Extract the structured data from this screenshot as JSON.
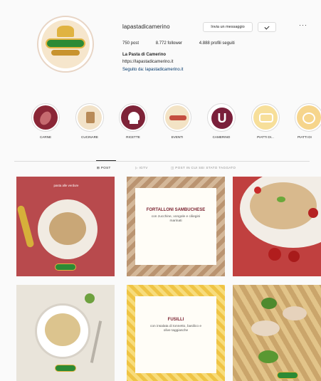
{
  "profile": {
    "username": "lapastadicamerino",
    "message_label": "Invia un messaggio",
    "follow_icon": "person-check-icon",
    "more_label": "···",
    "stats": {
      "posts": "750 post",
      "followers": "8.772 follower",
      "following": "4.888 profili seguiti"
    },
    "bio_name": "La Pasta di Camerino",
    "bio_link": "https://lapastadicamerino.it",
    "bio_link_tag": "Seguito da: lapastadicamerino.it"
  },
  "highlights": [
    {
      "label": "CARNE",
      "color": "#8a2636"
    },
    {
      "label": "CUCINARE",
      "color": "#f2e2c8"
    },
    {
      "label": "RICETTE",
      "color": "#7e2338"
    },
    {
      "label": "EVENTI",
      "color": "#f3e3c5"
    },
    {
      "label": "CAMERINO",
      "color": "#7a1f3a"
    },
    {
      "label": "PIATTI DI...",
      "color": "#f7df9a"
    },
    {
      "label": "PIATTI DI",
      "color": "#f6d58c"
    }
  ],
  "tabs": [
    {
      "label": "⊞ POST",
      "active": true
    },
    {
      "label": "▷ IGTV",
      "active": false
    },
    {
      "label": "◫ POST IN CUI SEI STATO TAGGATO",
      "active": false
    }
  ],
  "posts": [
    {
      "caption": "pasta alle verdure",
      "title": "",
      "sub": ""
    },
    {
      "caption": "",
      "title": "FORTALLONI SAMBUCHESE",
      "sub": "con zucchine, vongole e ciliegini marinati"
    },
    {
      "caption": "",
      "title": "",
      "sub": ""
    },
    {
      "caption": "",
      "title": "",
      "sub": ""
    },
    {
      "caption": "",
      "title": "FUSILLI",
      "sub": "con insalata di tonnetto, basilico e olive taggiasche"
    },
    {
      "caption": "",
      "title": "",
      "sub": ""
    }
  ],
  "colors": {
    "accent_red": "#b84a4d",
    "brand_green": "#2c8a35",
    "brand_gold": "#e0b341",
    "link_blue": "#00376b"
  }
}
